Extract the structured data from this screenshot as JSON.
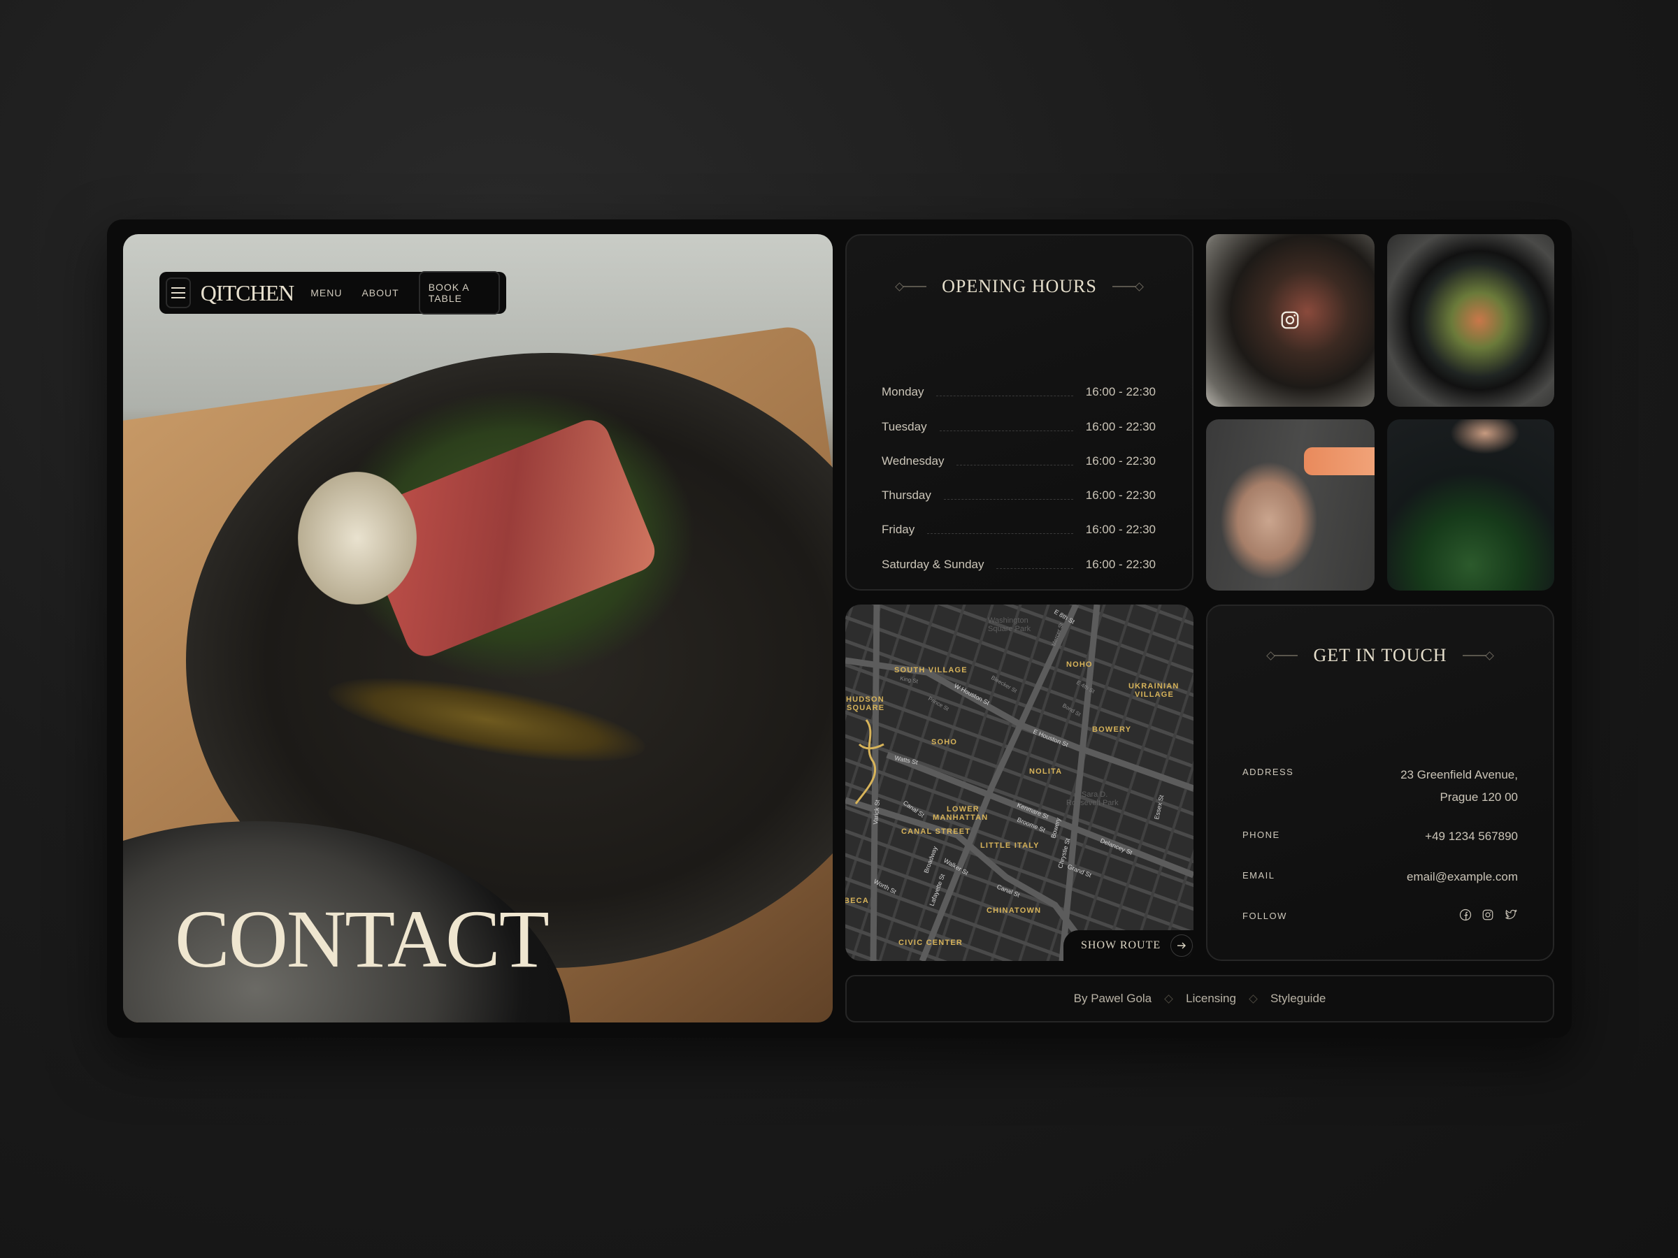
{
  "nav": {
    "logo": "QITCHEN",
    "links": [
      "MENU",
      "ABOUT"
    ],
    "book_label": "BOOK A TABLE"
  },
  "hero": {
    "title": "CONTACT"
  },
  "opening_hours": {
    "title": "OPENING HOURS",
    "rows": [
      {
        "day": "Monday",
        "hours": "16:00 - 22:30"
      },
      {
        "day": "Tuesday",
        "hours": "16:00 - 22:30"
      },
      {
        "day": "Wednesday",
        "hours": "16:00 - 22:30"
      },
      {
        "day": "Thursday",
        "hours": "16:00 - 22:30"
      },
      {
        "day": "Friday",
        "hours": "16:00 - 22:30"
      },
      {
        "day": "Saturday & Sunday",
        "hours": "16:00 - 22:30"
      }
    ]
  },
  "gallery": {
    "icons": [
      "instagram-icon"
    ]
  },
  "map": {
    "neighborhoods": [
      "SOUTH VILLAGE",
      "HUDSON",
      "SQUARE",
      "SOHO",
      "NOHO",
      "UKRAINIAN",
      "VILLAGE",
      "BOWERY",
      "NOLITA",
      "LOWER",
      "MANHATTAN",
      "CANAL STREET",
      "LITTLE ITALY",
      "CHINATOWN",
      "CIVIC CENTER",
      "BECA"
    ],
    "places": [
      "Washington",
      "Square Park",
      "Sara D.",
      "Roosevelt Park"
    ],
    "streets": [
      "W Houston St",
      "E Houston St",
      "Kenmare St",
      "Broome St",
      "Delancey St",
      "Canal St",
      "Canal St",
      "Walker St",
      "Worth St",
      "Grand St",
      "Watts St",
      "Broadway",
      "Lafayette St",
      "Bowery",
      "Chrystie St",
      "E 8th St",
      "Essex St",
      "Varick St",
      "King St",
      "Prince St",
      "Bleecker St",
      "E 4th St",
      "Bond St",
      "Mercer St"
    ],
    "route_label": "SHOW ROUTE",
    "colors": {
      "land": "#2d2d2d",
      "road": "#555555",
      "label": "#d8b45a"
    }
  },
  "contact": {
    "title": "GET IN TOUCH",
    "address_label": "ADDRESS",
    "address_line1": "23 Greenfield Avenue,",
    "address_line2": "Prague 120 00",
    "phone_label": "PHONE",
    "phone": "+49 1234 567890",
    "email_label": "EMAIL",
    "email": "email@example.com",
    "follow_label": "FOLLOW",
    "social": [
      "facebook-icon",
      "instagram-icon",
      "twitter-icon"
    ]
  },
  "footer": {
    "links": [
      "By Pawel Gola",
      "Licensing",
      "Styleguide"
    ]
  }
}
